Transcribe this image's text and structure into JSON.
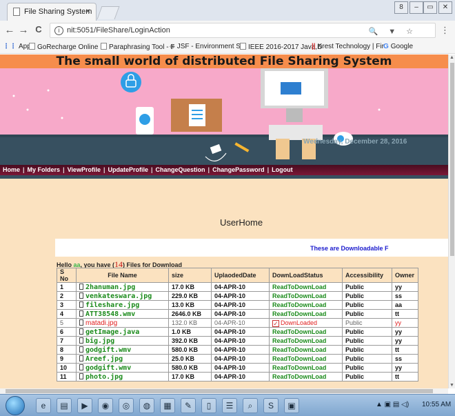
{
  "browser": {
    "tab_title": "File Sharing System",
    "tab_close": "×",
    "url": "nit:5051/FileShare/LoginAction",
    "back": "←",
    "forward": "→",
    "reload": "C",
    "info": "i",
    "omni_icons": "🔍 ▼ ☆",
    "menu": "⋮",
    "window_controls": [
      "8",
      "–",
      "▭",
      "✕"
    ]
  },
  "bookmarks": [
    {
      "label": "Apps"
    },
    {
      "label": "GoRecharge Online P"
    },
    {
      "label": "Paraphrasing Tool - F"
    },
    {
      "label": "JSF - Environment Set"
    },
    {
      "label": "IEEE 2016-2017 Java,D"
    },
    {
      "label": "Krest Technology | Fir"
    },
    {
      "label": "Google"
    }
  ],
  "page": {
    "banner_title": "The small world of distributed File Sharing System",
    "date_text": "Wednesday, December 28, 2016",
    "nav": [
      "Home",
      "My Folders",
      "ViewProfile",
      "UpdateProfile",
      "ChangeQuestion",
      "ChangePassword",
      "Logout"
    ],
    "nav_sep": "|",
    "heading": "UserHome",
    "marquee": "These are Downloadable F",
    "hello_prefix": "Hello ",
    "hello_user": "aa",
    "hello_mid": ", you have (",
    "hello_count": "14",
    "hello_suffix": ") Files for Download"
  },
  "table": {
    "headers": [
      "S No",
      "File Name",
      "size",
      "UplaodedDate",
      "DownLoadStatus",
      "Accessibility",
      "Owner"
    ],
    "rows": [
      {
        "sno": "1",
        "name": "2hanuman.jpg",
        "size": "17.0 KB",
        "date": "04-APR-10",
        "status": "ReadToDownLoad",
        "access": "Public",
        "owner": "yy",
        "downloaded": false
      },
      {
        "sno": "2",
        "name": "venkateswara.jpg",
        "size": "229.0 KB",
        "date": "04-APR-10",
        "status": "ReadToDownLoad",
        "access": "Public",
        "owner": "ss",
        "downloaded": false
      },
      {
        "sno": "3",
        "name": "fileshare.jpg",
        "size": "13.0 KB",
        "date": "04-APR-10",
        "status": "ReadToDownLoad",
        "access": "Public",
        "owner": "aa",
        "downloaded": false
      },
      {
        "sno": "4",
        "name": "ATT38548.wmv",
        "size": "2646.0 KB",
        "date": "04-APR-10",
        "status": "ReadToDownLoad",
        "access": "Public",
        "owner": "tt",
        "downloaded": false
      },
      {
        "sno": "5",
        "name": "matadi.jpg",
        "size": "132.0 KB",
        "date": "04-APR-10",
        "status": "DownLoaded",
        "access": "Public",
        "owner": "yy",
        "downloaded": true
      },
      {
        "sno": "6",
        "name": "getImage.java",
        "size": "1.0 KB",
        "date": "04-APR-10",
        "status": "ReadToDownLoad",
        "access": "Public",
        "owner": "yy",
        "downloaded": false
      },
      {
        "sno": "7",
        "name": "big.jpg",
        "size": "392.0 KB",
        "date": "04-APR-10",
        "status": "ReadToDownLoad",
        "access": "Public",
        "owner": "yy",
        "downloaded": false
      },
      {
        "sno": "8",
        "name": "godgift.wmv",
        "size": "580.0 KB",
        "date": "04-APR-10",
        "status": "ReadToDownLoad",
        "access": "Public",
        "owner": "tt",
        "downloaded": false
      },
      {
        "sno": "9",
        "name": "Areef.jpg",
        "size": "25.0 KB",
        "date": "04-APR-10",
        "status": "ReadToDownLoad",
        "access": "Public",
        "owner": "ss",
        "downloaded": false
      },
      {
        "sno": "10",
        "name": "godgift.wmv",
        "size": "580.0 KB",
        "date": "04-APR-10",
        "status": "ReadToDownLoad",
        "access": "Public",
        "owner": "yy",
        "downloaded": false
      },
      {
        "sno": "11",
        "name": "photo.jpg",
        "size": "17.0 KB",
        "date": "04-APR-10",
        "status": "ReadToDownLoad",
        "access": "Public",
        "owner": "tt",
        "downloaded": false
      }
    ]
  },
  "taskbar": {
    "clock": "10:55 AM",
    "apps": [
      "ie-icon",
      "explorer-icon",
      "media-player-icon",
      "firefox-icon",
      "chrome-icon",
      "virtualbox-icon",
      "app-icon",
      "paint-icon",
      "notepad-icon",
      "text-icon",
      "search-icon",
      "skype-icon",
      "window-icon"
    ],
    "app_glyphs": [
      "e",
      "▤",
      "▶",
      "◉",
      "◎",
      "◍",
      "▦",
      "✎",
      "▯",
      "☰",
      "⌕",
      "S",
      "▣"
    ],
    "tray": "▲ ▣ ▤ ◁)"
  },
  "colors": {
    "banner": "#f68d4c",
    "hero_pink": "#f7a9c9",
    "nav_bg": "#6a1430",
    "page_bg": "#fbe2c0",
    "ready_green": "#1a8a1a",
    "downloaded_red": "#e02020",
    "marquee_blue": "#1a1acd"
  }
}
